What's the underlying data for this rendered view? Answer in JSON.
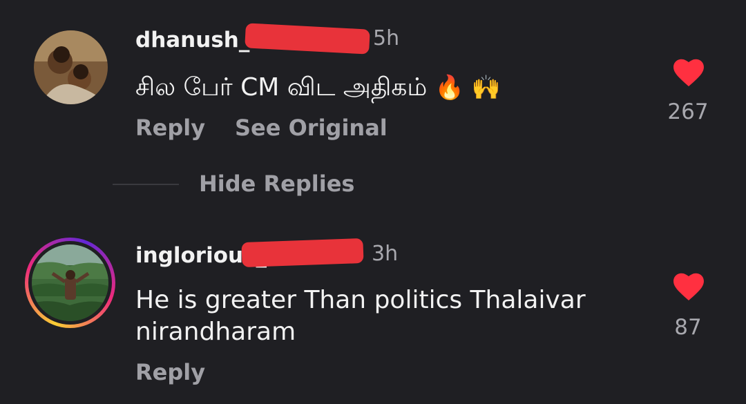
{
  "comments": [
    {
      "username": "dhanush_",
      "time": "5h",
      "text": "சில பேர் CM விட அதிகம்",
      "emojis": "🔥 🙌",
      "like_count": "267",
      "liked": true,
      "reply_label": "Reply",
      "see_original_label": "See Original"
    },
    {
      "username": "inglorious_",
      "time": "3h",
      "text_line1": "He is greater Than politics Thalaivar",
      "text_line2": "nirandharam",
      "like_count": "87",
      "liked": true,
      "reply_label": "Reply",
      "has_story_ring": true
    }
  ],
  "thread": {
    "hide_replies_label": "Hide Replies"
  },
  "colors": {
    "background": "#1f1f23",
    "heart": "#ff3040",
    "redaction": "#e8333a"
  },
  "icons": [
    "heart-icon",
    "fire-emoji",
    "raised-hands-emoji"
  ]
}
